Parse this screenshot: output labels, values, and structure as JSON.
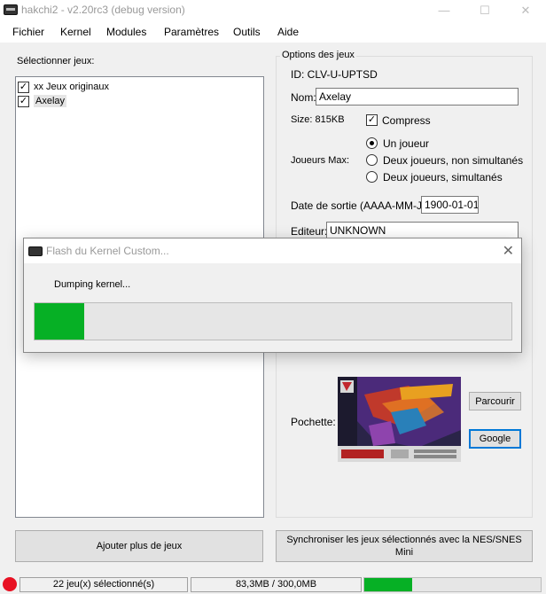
{
  "window": {
    "title": "hakchi2 - v2.20rc3 (debug version)",
    "minimize": "—",
    "maximize": "☐",
    "close": "✕"
  },
  "menu": [
    "Fichier",
    "Kernel",
    "Modules",
    "Paramètres",
    "Outils",
    "Aide"
  ],
  "left": {
    "label": "Sélectionner jeux:",
    "items": [
      {
        "label": "xx Jeux originaux",
        "checked": true
      },
      {
        "label": "Axelay",
        "checked": true
      }
    ],
    "add_button": "Ajouter plus de jeux"
  },
  "options": {
    "title": "Options des jeux",
    "id": "ID: CLV-U-UPTSD",
    "name_label": "Nom:",
    "name_value": "Axelay",
    "size": "Size: 815KB",
    "compress_label": "Compress",
    "players_label": "Joueurs Max:",
    "players": [
      "Un joueur",
      "Deux joueurs, non simultanés",
      "Deux joueurs, simultanés"
    ],
    "release_label": "Date de sortie (AAAA-MM-JJ):",
    "release_value": "1900-01-01",
    "publisher_label": "Editeur:",
    "publisher_value": "UNKNOWN",
    "cover_label": "Pochette:",
    "browse_button": "Parcourir",
    "google_button": "Google"
  },
  "sync_button": "Synchroniser les jeux sélectionnés avec la NES/SNES Mini",
  "status": {
    "games": "22 jeu(x) sélectionné(s)",
    "size": "83,3MB / 300,0MB",
    "progress": 0.27,
    "indicator_color": "#e81123"
  },
  "dialog": {
    "title": "Flash du Kernel Custom...",
    "message": "Dumping kernel...",
    "close": "✕",
    "progress": 0.105
  },
  "colors": {
    "progress": "#06b025",
    "focus": "#0078d7"
  }
}
